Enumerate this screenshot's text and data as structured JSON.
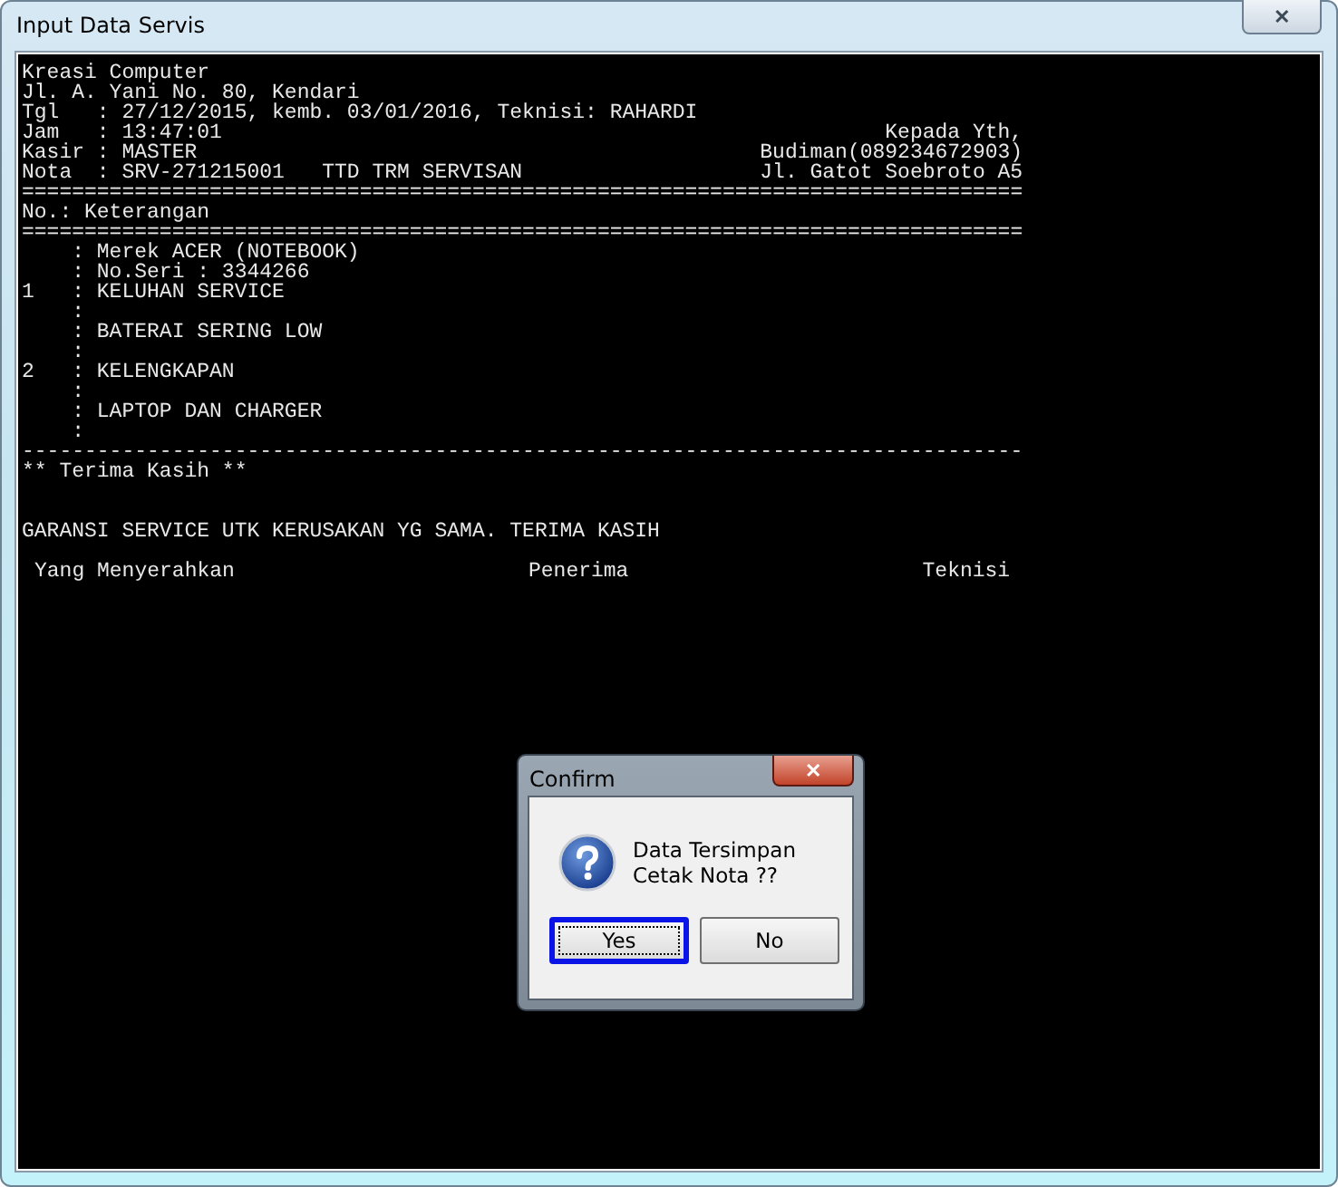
{
  "window": {
    "title": "Input Data Servis",
    "close": "✕"
  },
  "report": {
    "lines": [
      {
        "kind": "text",
        "text": "Kreasi Computer"
      },
      {
        "kind": "text",
        "text": "Jl. A. Yani No. 80, Kendari"
      },
      {
        "kind": "text",
        "text": "Tgl   : 27/12/2015, kemb. 03/01/2016, Teknisi: RAHARDI"
      },
      {
        "kind": "split",
        "left": "Jam   : 13:47:01",
        "right": "Kepada Yth,"
      },
      {
        "kind": "split",
        "left": "Kasir : MASTER",
        "right": "Budiman(089234672903)"
      },
      {
        "kind": "split",
        "left": "Nota  : SRV-271215001   TTD TRM SERVISAN",
        "right": "Jl. Gatot Soebroto A5"
      },
      {
        "kind": "text",
        "text": "================================================================================"
      },
      {
        "kind": "text",
        "text": "No.: Keterangan"
      },
      {
        "kind": "text",
        "text": "================================================================================"
      },
      {
        "kind": "text",
        "text": "    : Merek ACER (NOTEBOOK)"
      },
      {
        "kind": "text",
        "text": "    : No.Seri : 3344266"
      },
      {
        "kind": "text",
        "text": "1   : KELUHAN SERVICE"
      },
      {
        "kind": "text",
        "text": "    :"
      },
      {
        "kind": "text",
        "text": "    : BATERAI SERING LOW"
      },
      {
        "kind": "text",
        "text": "    :"
      },
      {
        "kind": "text",
        "text": "2   : KELENGKAPAN"
      },
      {
        "kind": "text",
        "text": "    :"
      },
      {
        "kind": "text",
        "text": "    : LAPTOP DAN CHARGER"
      },
      {
        "kind": "text",
        "text": "    :"
      },
      {
        "kind": "text",
        "text": "--------------------------------------------------------------------------------"
      },
      {
        "kind": "text",
        "text": "** Terima Kasih **"
      },
      {
        "kind": "blank"
      },
      {
        "kind": "blank"
      },
      {
        "kind": "text",
        "text": "GARANSI SERVICE UTK KERUSAKAN YG SAMA. TERIMA KASIH"
      },
      {
        "kind": "blank"
      },
      {
        "kind": "columns",
        "columns": [
          "Yang Menyerahkan",
          "Penerima",
          "Teknisi"
        ]
      }
    ]
  },
  "dialog": {
    "title": "Confirm",
    "close": "✕",
    "message_lines": [
      "Data Tersimpan",
      "Cetak Nota ??"
    ],
    "buttons": [
      {
        "label": "Yes",
        "focused": true
      },
      {
        "label": "No",
        "focused": false
      }
    ]
  }
}
